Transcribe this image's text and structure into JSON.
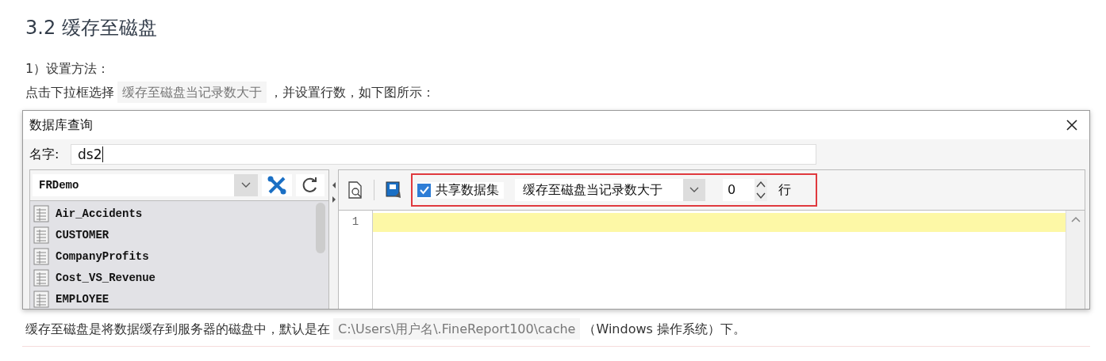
{
  "heading": "3.2 缓存至磁盘",
  "step": "1）设置方法：",
  "instruction": {
    "before": "点击下拉框选择",
    "code": "缓存至磁盘当记录数大于",
    "after": "，并设置行数，如下图所示："
  },
  "dialog": {
    "title": "数据库查询",
    "name_label": "名字:",
    "name_value": "ds2",
    "connection": "FRDemo",
    "tables": [
      "Air_Accidents",
      "CUSTOMER",
      "CompanyProfits",
      "Cost_VS_Revenue",
      "EMPLOYEE"
    ],
    "shared_dataset": {
      "label": "共享数据集",
      "checked": true
    },
    "cache_mode": "缓存至磁盘当记录数大于",
    "row_count": "0",
    "row_unit": "行",
    "line_numbers": [
      "1"
    ]
  },
  "note": {
    "before": "缓存至磁盘是将数据缓存到服务器的磁盘中，默认是在",
    "code": "C:\\Users\\用户名\\.FineReport100\\cache",
    "after": "（Windows 操作系统）下。"
  }
}
